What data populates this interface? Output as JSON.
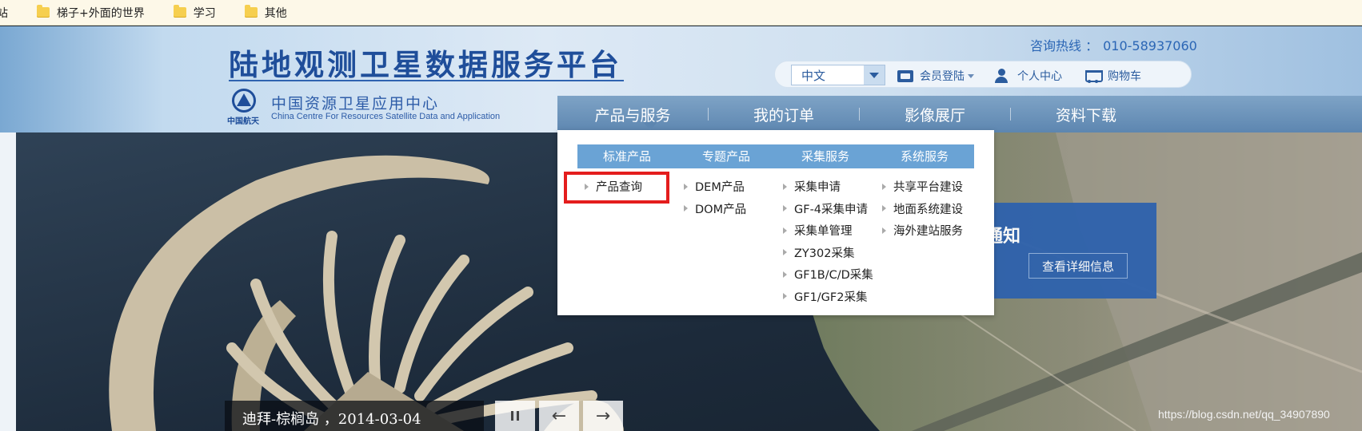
{
  "bookmarks": {
    "partial": "站",
    "items": [
      "梯子+外面的世界",
      "学习",
      "其他"
    ]
  },
  "header": {
    "title": "陆地观测卫星数据服务平台",
    "logo_text": "中国航天",
    "center_cn": "中国资源卫星应用中心",
    "center_en": "China Centre For Resources Satellite Data and Application",
    "hotline_label": "咨询热线 ：",
    "hotline_number": "010-58937060",
    "language": "中文",
    "login": "会员登陆",
    "user_center": "个人中心",
    "cart": "购物车"
  },
  "nav": {
    "items": [
      "产品与服务",
      "我的订单",
      "影像展厅",
      "资料下载"
    ],
    "active": "产品与服务"
  },
  "dropdown": {
    "tabs": [
      "标准产品",
      "专题产品",
      "采集服务",
      "系统服务"
    ],
    "columns": [
      [
        "产品查询"
      ],
      [
        "DEM产品",
        "DOM产品"
      ],
      [
        "采集申请",
        "GF-4采集申请",
        "采集单管理",
        "ZY302采集",
        "GF1B/C/D采集",
        "GF1/GF2采集"
      ],
      [
        "共享平台建设",
        "地面系统建设",
        "海外建站服务"
      ]
    ],
    "highlighted": "产品查询"
  },
  "notice": {
    "title_partial": "通知",
    "button": "查看详细信息"
  },
  "slider": {
    "caption": "迪拜-棕榈岛 ，2014-03-04",
    "pause_icon": "pause-icon",
    "prev_icon": "←",
    "next_icon": "→"
  },
  "watermark": "https://blog.csdn.net/qq_34907890",
  "colors": {
    "brand_blue": "#1f4e9a",
    "nav_bg": "#5d86b0",
    "dropdown_tab_bg": "#6aa3d5",
    "highlight_red": "#e41d1d",
    "notice_bg": "#2e62ad"
  }
}
